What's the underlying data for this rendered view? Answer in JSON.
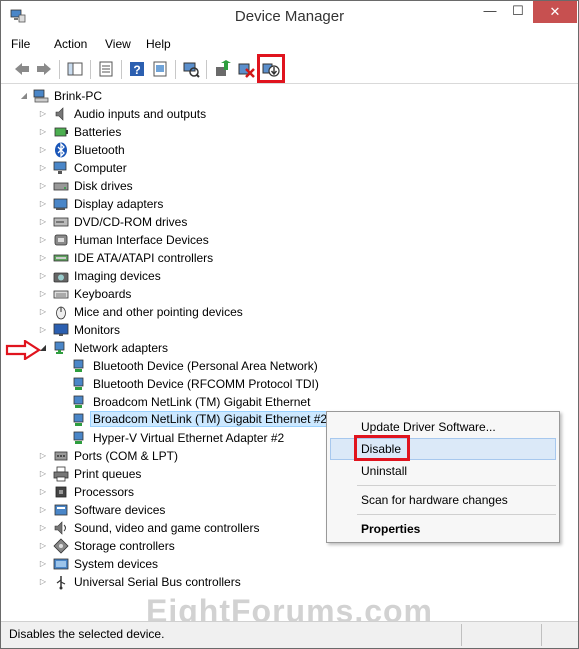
{
  "window": {
    "title": "Device Manager",
    "minimize_glyph": "—",
    "maximize_glyph": "☐",
    "close_glyph": "✕"
  },
  "menu": [
    "File",
    "Action",
    "View",
    "Help"
  ],
  "toolbar": {
    "icons": [
      "back-icon",
      "forward-icon",
      "show-hide-console-tree-icon",
      "properties-icon",
      "help-icon",
      "show-hidden-icon",
      "scan-hardware-icon",
      "update-driver-icon",
      "uninstall-icon",
      "disable-device-icon"
    ],
    "highlighted": "disable-device-icon"
  },
  "tree": {
    "root": "Brink-PC",
    "categories": [
      {
        "label": "Audio inputs and outputs",
        "icon": "speaker-icon",
        "expanded": false
      },
      {
        "label": "Batteries",
        "icon": "battery-icon",
        "expanded": false
      },
      {
        "label": "Bluetooth",
        "icon": "bluetooth-icon",
        "expanded": false
      },
      {
        "label": "Computer",
        "icon": "computer-icon",
        "expanded": false
      },
      {
        "label": "Disk drives",
        "icon": "disk-drive-icon",
        "expanded": false
      },
      {
        "label": "Display adapters",
        "icon": "display-adapter-icon",
        "expanded": false
      },
      {
        "label": "DVD/CD-ROM drives",
        "icon": "dvd-drive-icon",
        "expanded": false
      },
      {
        "label": "Human Interface Devices",
        "icon": "hid-icon",
        "expanded": false
      },
      {
        "label": "IDE ATA/ATAPI controllers",
        "icon": "ide-controller-icon",
        "expanded": false
      },
      {
        "label": "Imaging devices",
        "icon": "camera-icon",
        "expanded": false
      },
      {
        "label": "Keyboards",
        "icon": "keyboard-icon",
        "expanded": false
      },
      {
        "label": "Mice and other pointing devices",
        "icon": "mouse-icon",
        "expanded": false
      },
      {
        "label": "Monitors",
        "icon": "monitor-icon",
        "expanded": false
      },
      {
        "label": "Network adapters",
        "icon": "network-adapter-icon",
        "expanded": true
      },
      {
        "label": "Ports (COM & LPT)",
        "icon": "port-icon",
        "expanded": false
      },
      {
        "label": "Print queues",
        "icon": "printer-icon",
        "expanded": false
      },
      {
        "label": "Processors",
        "icon": "processor-icon",
        "expanded": false
      },
      {
        "label": "Software devices",
        "icon": "software-device-icon",
        "expanded": false
      },
      {
        "label": "Sound, video and game controllers",
        "icon": "sound-icon",
        "expanded": false
      },
      {
        "label": "Storage controllers",
        "icon": "storage-icon",
        "expanded": false
      },
      {
        "label": "System devices",
        "icon": "system-device-icon",
        "expanded": false
      },
      {
        "label": "Universal Serial Bus controllers",
        "icon": "usb-icon",
        "expanded": false
      }
    ],
    "network_children": [
      "Bluetooth Device (Personal Area Network)",
      "Bluetooth Device (RFCOMM Protocol TDI)",
      "Broadcom NetLink (TM) Gigabit Ethernet",
      "Broadcom NetLink (TM) Gigabit Ethernet #2",
      "Hyper-V Virtual Ethernet Adapter #2"
    ],
    "selected_child": "Broadcom NetLink (TM) Gigabit Ethernet #2"
  },
  "context_menu": {
    "items": [
      "Update Driver Software...",
      "Disable",
      "Uninstall",
      "Scan for hardware changes",
      "Properties"
    ],
    "hovered": "Disable",
    "default_bold": "Properties"
  },
  "watermark": "EightForums.com",
  "status": "Disables the selected device.",
  "colors": {
    "highlight_red": "#e0141e",
    "selection": "#cce8ff",
    "close_button": "#c75050"
  }
}
